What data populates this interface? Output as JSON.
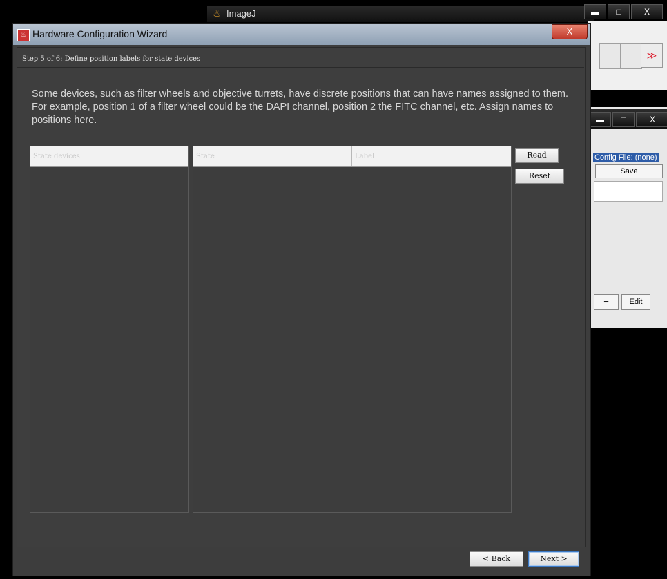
{
  "background": {
    "imagej_title": "ImageJ",
    "imagej_more": "≫",
    "mm_config_label": "Config File: (none)",
    "mm_save": "Save",
    "mm_minus": "−",
    "mm_edit": "Edit"
  },
  "window_controls": {
    "minimize": "▬",
    "maximize": "□",
    "close": "X"
  },
  "wizard": {
    "title": "Hardware Configuration Wizard",
    "close": "X",
    "step_label": "Step 5 of 6: Define position labels for state devices",
    "description": "Some devices, such as filter wheels and objective turrets, have discrete positions that can have names assigned to them. For example, position 1 of a filter wheel could be the DAPI channel, position 2 the FITC channel, etc. Assign names to positions here.",
    "devices_table": {
      "header": "State devices"
    },
    "positions_table": {
      "headers": [
        "State",
        "Label"
      ]
    },
    "buttons": {
      "read": "Read",
      "reset": "Reset",
      "back": "< Back",
      "next": "Next >"
    }
  },
  "colors": {
    "dialog_bg": "#3d3d3d",
    "titlebar": "#a6b4c5",
    "close_button": "#c0392b",
    "header_bg": "#f2f2f2",
    "text": "#d6d6d6"
  }
}
